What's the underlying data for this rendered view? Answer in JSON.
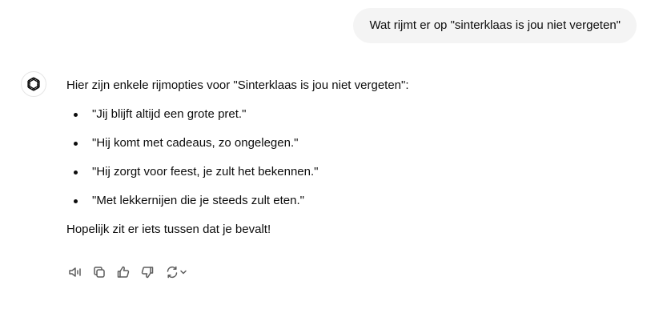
{
  "user_message": {
    "text": "Wat rijmt er op \"sinterklaas is jou niet vergeten\""
  },
  "assistant_message": {
    "avatar_icon": "openai-logo-icon",
    "intro": "Hier zijn enkele rijmopties voor \"Sinterklaas is jou niet vergeten\":",
    "options": [
      "\"Jij blijft altijd een grote pret.\"",
      "\"Hij komt met cadeaus, zo ongelegen.\"",
      "\"Hij zorgt voor feest, je zult het bekennen.\"",
      "\"Met lekkernijen die je steeds zult eten.\""
    ],
    "outro": "Hopelijk zit er iets tussen dat je bevalt!"
  },
  "actions": [
    {
      "name": "read-aloud",
      "icon": "speaker-icon"
    },
    {
      "name": "copy",
      "icon": "copy-icon"
    },
    {
      "name": "good-response",
      "icon": "thumbs-up-icon"
    },
    {
      "name": "bad-response",
      "icon": "thumbs-down-icon"
    },
    {
      "name": "regenerate",
      "icon": "regenerate-icon"
    }
  ],
  "colors": {
    "user_bubble_bg": "#f4f4f4",
    "text": "#0d0d0d",
    "icon": "#5d5d5d"
  }
}
